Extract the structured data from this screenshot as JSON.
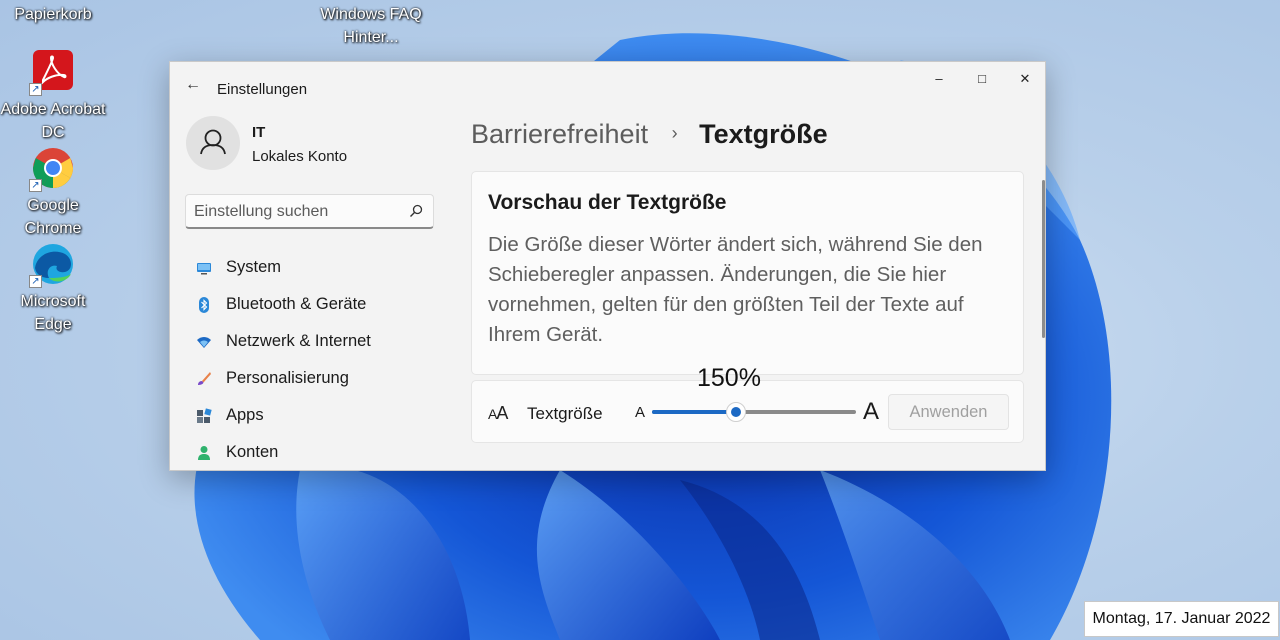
{
  "desktop": {
    "icons": [
      {
        "label": "Papierkorb",
        "icon": "recycle-bin-icon"
      },
      {
        "label": "Windows FAQ Hinter...",
        "icon": "folder-shortcut-icon"
      },
      {
        "label": "Adobe Acrobat DC",
        "icon": "acrobat-icon"
      },
      {
        "label": "Google Chrome",
        "icon": "chrome-icon"
      },
      {
        "label": "Microsoft Edge",
        "icon": "edge-icon"
      }
    ],
    "date_caption": "Montag, 17. Januar 2022"
  },
  "window": {
    "title": "Einstellungen",
    "controls": {
      "minimize": "–",
      "maximize": "□",
      "close": "✕"
    },
    "back_glyph": "←"
  },
  "account": {
    "name": "IT",
    "type": "Lokales Konto"
  },
  "search": {
    "placeholder": "Einstellung suchen"
  },
  "sidebar": {
    "items": [
      {
        "label": "System",
        "icon": "monitor-icon"
      },
      {
        "label": "Bluetooth & Geräte",
        "icon": "bluetooth-icon"
      },
      {
        "label": "Netzwerk & Internet",
        "icon": "wifi-icon"
      },
      {
        "label": "Personalisierung",
        "icon": "brush-icon"
      },
      {
        "label": "Apps",
        "icon": "apps-icon"
      },
      {
        "label": "Konten",
        "icon": "person-icon"
      }
    ]
  },
  "breadcrumb": {
    "parent": "Barrierefreiheit",
    "separator": "›",
    "current": "Textgröße"
  },
  "preview": {
    "title": "Vorschau der Textgröße",
    "body": "Die Größe dieser Wörter ändert sich, während Sie den Schieberegler anpassen. Änderungen, die Sie hier vornehmen, gelten für den größten Teil der Texte auf Ihrem Gerät."
  },
  "text_size": {
    "icon_small": "A",
    "icon_big": "A",
    "label": "Textgröße",
    "min_label": "A",
    "max_label": "A",
    "value_label": "150%",
    "value_fraction": 0.41,
    "apply_label": "Anwenden"
  },
  "colors": {
    "accent": "#1c69c4",
    "window_bg": "#f3f3f3",
    "card_bg": "#fbfbfb"
  }
}
